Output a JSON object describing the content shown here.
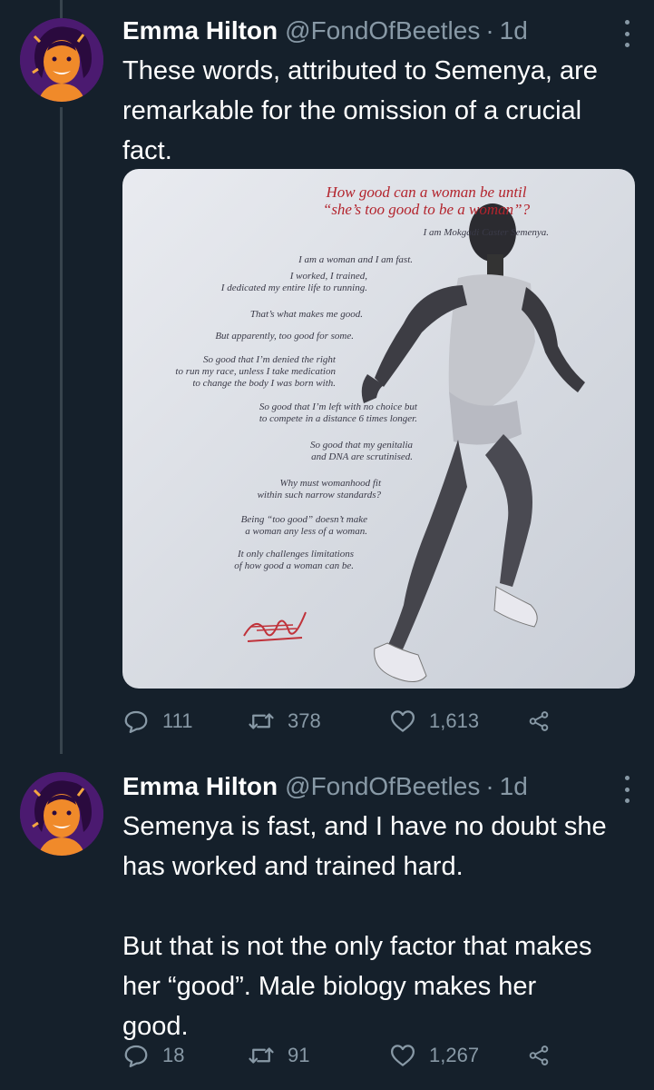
{
  "tweets": [
    {
      "display_name": "Emma Hilton",
      "handle": "@FondOfBeetles",
      "separator": "·",
      "time": "1d",
      "text": "These words, attributed to Semenya, are\nremarkable for the omission of a crucial\nfact.",
      "media": {
        "title": "How good can a woman be until\n“she’s too good to be a woman”?",
        "name_line": "I am Mokgadi Caster Semenya.",
        "lines": [
          "I am a woman and I am fast.",
          "I worked, I trained,\nI dedicated my entire life to running.",
          "That’s what makes me good.",
          "But apparently, too good for some.",
          "So good that I’m denied the right\nto run my race, unless I take medication\nto change the body I was born with.",
          "So good that I’m left with no choice but\nto compete in a distance 6 times longer.",
          "So good that my genitalia\nand DNA are scrutinised.",
          "Why must womanhood fit\nwithin such narrow standards?",
          "Being “too good” doesn’t make\na woman any less of a woman.",
          "It only challenges limitations\nof how good a woman can be."
        ]
      },
      "replies": "111",
      "retweets": "378",
      "likes": "1,613"
    },
    {
      "display_name": "Emma Hilton",
      "handle": "@FondOfBeetles",
      "separator": "·",
      "time": "1d",
      "text": "Semenya is fast, and I have no doubt she\nhas worked and trained hard.\n\nBut that is not the only factor that makes\nher “good”. Male biology makes her\ngood.",
      "replies": "18",
      "retweets": "91",
      "likes": "1,267"
    }
  ],
  "icons": {
    "reply": "reply-icon",
    "retweet": "retweet-icon",
    "like": "heart-icon",
    "share": "share-icon",
    "more": "more-vertical-icon"
  },
  "colors": {
    "background": "#15202b",
    "secondary_text": "#8899a6",
    "thread_line": "#38444d",
    "ad_title_red": "#b3242d"
  }
}
